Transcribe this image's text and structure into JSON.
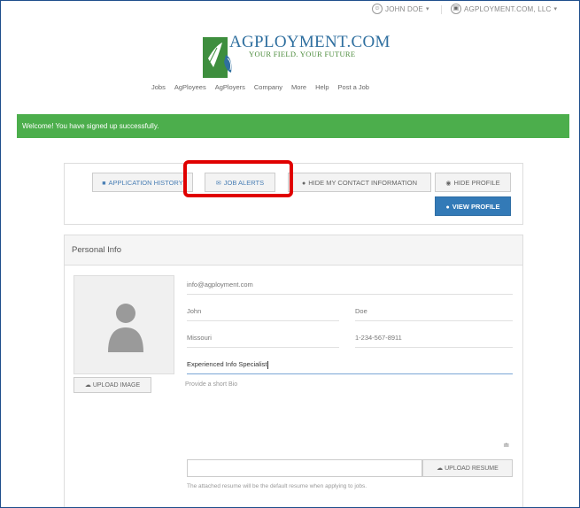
{
  "header": {
    "user_name": "JOHN DOE",
    "company_name": "AGPLOYMENT.COM, LLC"
  },
  "logo": {
    "brand": "AGPLOYMENT.COM",
    "tagline": "YOUR FIELD. YOUR FUTURE"
  },
  "nav": {
    "items": [
      "Jobs",
      "AgPloyees",
      "AgPloyers",
      "Company",
      "More",
      "Help",
      "Post a Job"
    ]
  },
  "alert": {
    "message": "Welcome! You have signed up successfully."
  },
  "actions": {
    "application_history": "APPLICATION HISTORY",
    "job_alerts": "JOB ALERTS",
    "hide_contact": "HIDE MY CONTACT INFORMATION",
    "hide_profile": "HIDE PROFILE",
    "view_profile": "VIEW PROFILE"
  },
  "profile": {
    "section_title": "Personal Info",
    "email": "info@agployment.com",
    "first_name": "John",
    "last_name": "Doe",
    "state": "Missouri",
    "phone": "1-234-567-8911",
    "headline": "Experienced Info Specialist",
    "bio_placeholder": "Provide a short Bio",
    "upload_image_label": "UPLOAD IMAGE",
    "upload_resume_label": "UPLOAD RESUME",
    "resume_help": "The attached resume will be the default resume when applying to jobs."
  },
  "colors": {
    "success": "#4cae4c",
    "primary": "#337ab7",
    "highlight": "#e00000",
    "brand_blue": "#2f6f9f",
    "brand_green": "#4a8a3a"
  }
}
